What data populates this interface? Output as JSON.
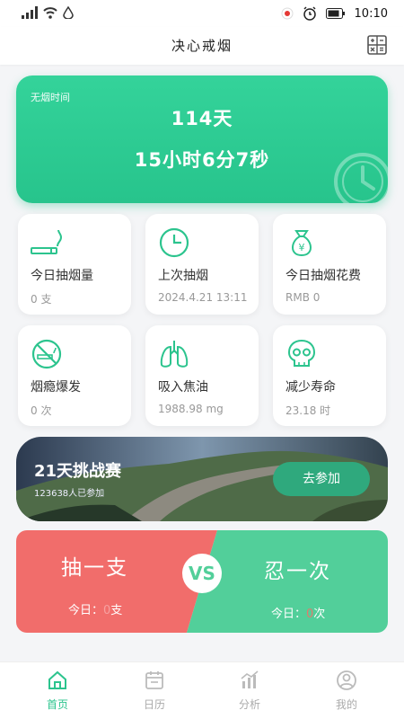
{
  "status_bar": {
    "time": "10:10"
  },
  "nav": {
    "title": "决心戒烟"
  },
  "hero": {
    "label": "无烟时间",
    "days": "114天",
    "time": "15小时6分7秒"
  },
  "stats": [
    {
      "icon": "cigarette-icon",
      "title": "今日抽烟量",
      "value": "0 支"
    },
    {
      "icon": "clock-icon",
      "title": "上次抽烟",
      "value": "2024.4.21 13:11"
    },
    {
      "icon": "money-bag-icon",
      "title": "今日抽烟花费",
      "value": "RMB 0"
    },
    {
      "icon": "no-smoking-icon",
      "title": "烟瘾爆发",
      "value": "0 次"
    },
    {
      "icon": "lungs-icon",
      "title": "吸入焦油",
      "value": "1988.98 mg"
    },
    {
      "icon": "skull-icon",
      "title": "减少寿命",
      "value": "23.18 时"
    }
  ],
  "challenge": {
    "title": "21天挑战赛",
    "participants": "123638人已参加",
    "button": "去参加"
  },
  "versus": {
    "left_title": "抽一支",
    "left_today_prefix": "今日：",
    "left_count": "0",
    "left_unit": "支",
    "vs": "VS",
    "right_title": "忍一次",
    "right_today_prefix": "今日：",
    "right_count": "0",
    "right_unit": "次"
  },
  "tabs": [
    {
      "label": "首页",
      "icon": "home-icon",
      "active": true
    },
    {
      "label": "日历",
      "icon": "calendar-icon",
      "active": false
    },
    {
      "label": "分析",
      "icon": "chart-icon",
      "active": false
    },
    {
      "label": "我的",
      "icon": "user-icon",
      "active": false
    }
  ],
  "colors": {
    "primary": "#2cc48e",
    "red": "#f16d6b",
    "green": "#52cf9a"
  }
}
